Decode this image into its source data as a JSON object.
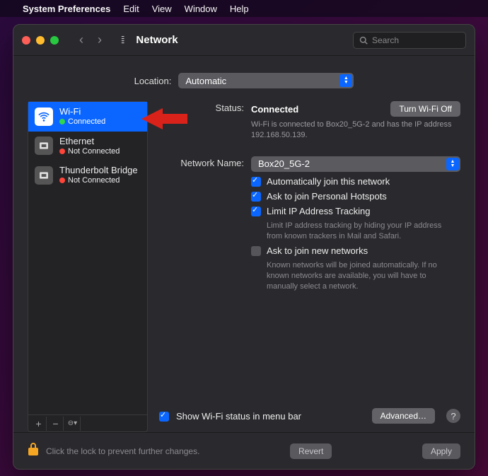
{
  "menubar": {
    "app_name": "System Preferences",
    "items": [
      "Edit",
      "View",
      "Window",
      "Help"
    ]
  },
  "toolbar": {
    "title": "Network",
    "search_placeholder": "Search"
  },
  "location": {
    "label": "Location:",
    "value": "Automatic"
  },
  "sidebar": {
    "items": [
      {
        "name": "Wi-Fi",
        "status": "Connected",
        "status_color": "green",
        "icon": "wifi",
        "active": true
      },
      {
        "name": "Ethernet",
        "status": "Not Connected",
        "status_color": "red",
        "icon": "ethernet",
        "active": false
      },
      {
        "name": "Thunderbolt Bridge",
        "status": "Not Connected",
        "status_color": "red",
        "icon": "thunderbolt",
        "active": false
      }
    ]
  },
  "detail": {
    "status_label": "Status:",
    "status_value": "Connected",
    "toggle_button": "Turn Wi-Fi Off",
    "status_text": "Wi-Fi is connected to Box20_5G-2 and has the IP address 192.168.50.139.",
    "network_label": "Network Name:",
    "network_value": "Box20_5G-2",
    "opts": {
      "auto_join": "Automatically join this network",
      "personal_hotspot": "Ask to join Personal Hotspots",
      "limit_ip": "Limit IP Address Tracking",
      "limit_ip_desc": "Limit IP address tracking by hiding your IP address from known trackers in Mail and Safari.",
      "ask_join": "Ask to join new networks",
      "ask_join_desc": "Known networks will be joined automatically. If no known networks are available, you will have to manually select a network."
    },
    "show_status": "Show Wi-Fi status in menu bar",
    "advanced": "Advanced…"
  },
  "footer": {
    "lock_text": "Click the lock to prevent further changes.",
    "revert": "Revert",
    "apply": "Apply"
  }
}
